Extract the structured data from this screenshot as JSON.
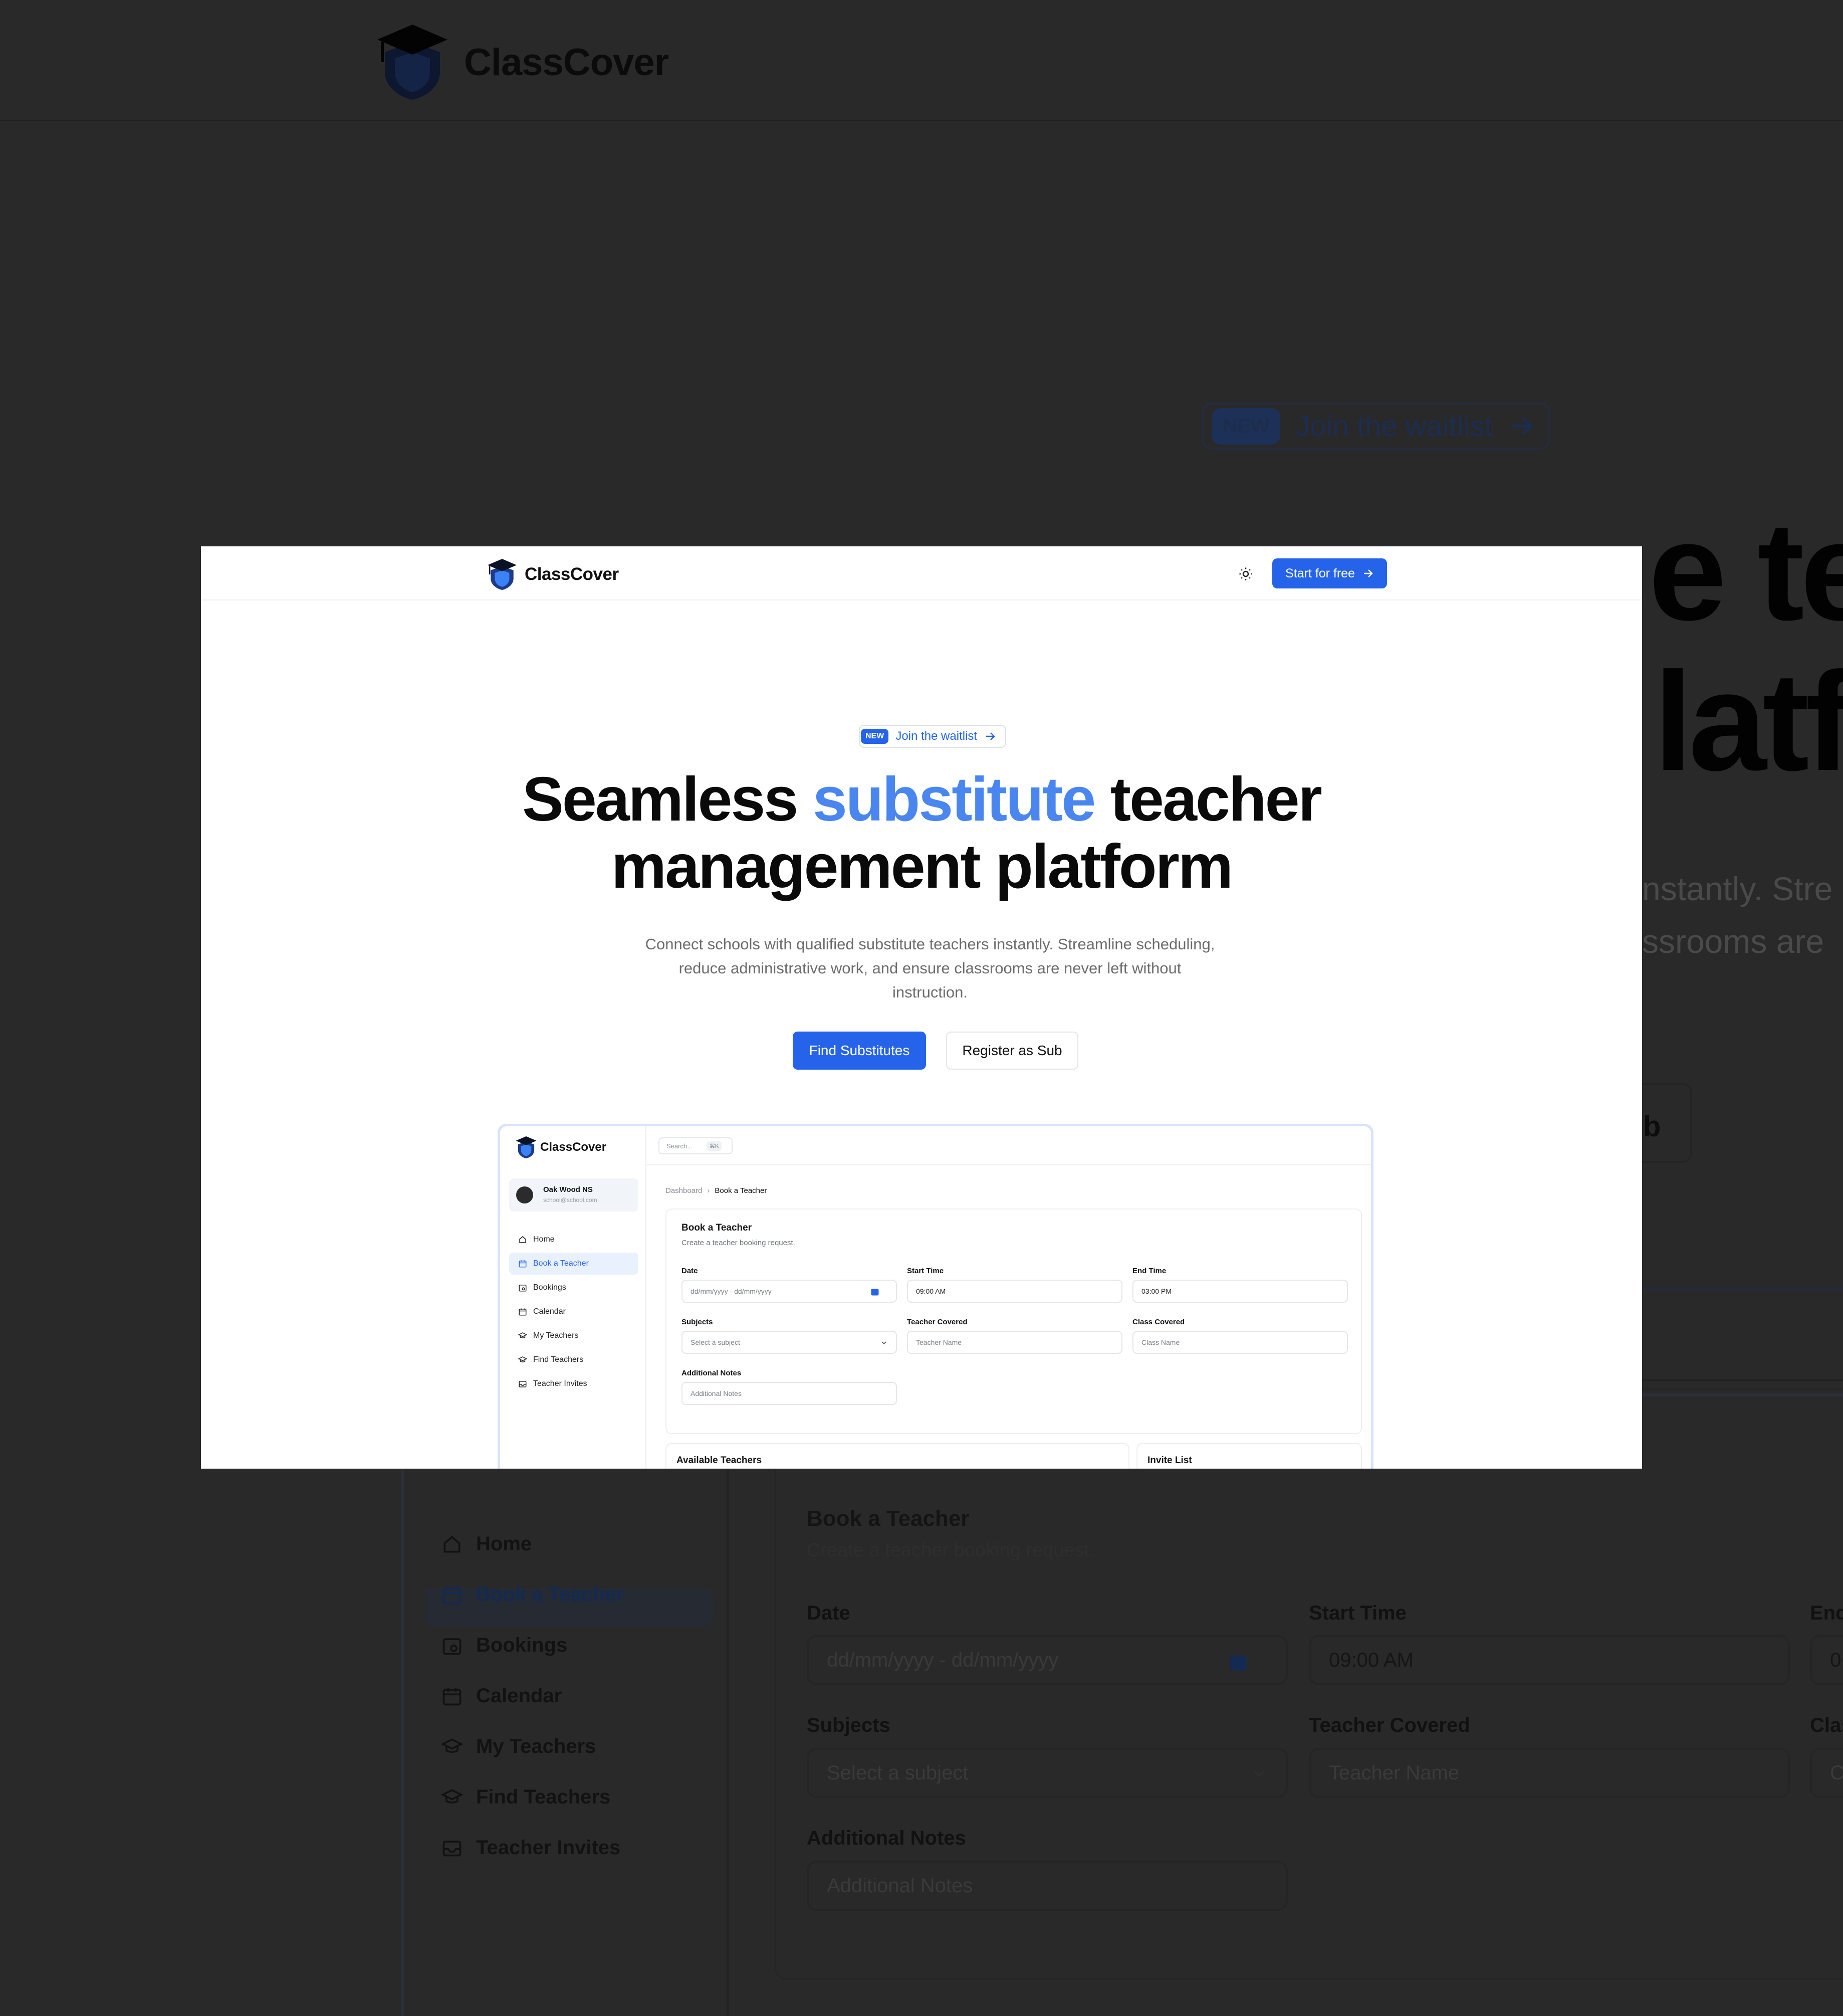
{
  "background": {
    "brand_name": "ClassCover",
    "pill_badge": "NEW",
    "pill_text": "Join the waitlist",
    "hero_line1_fragment": "e te",
    "hero_line2_fragment": "latfo",
    "sub_line1_fragment": "nstantly. Stre",
    "sub_line2_fragment": "ssrooms are",
    "btn_fragment": "b",
    "sidebar": [
      "Home",
      "Book a Teacher",
      "Bookings",
      "Calendar",
      "My Teachers",
      "Find Teachers",
      "Teacher Invites"
    ],
    "card_title": "Book a Teacher",
    "card_desc": "Create a teacher booking request.",
    "fields": {
      "date_label": "Date",
      "date_placeholder": "dd/mm/yyyy - dd/mm/yyyy",
      "start_label": "Start Time",
      "start_value": "09:00 AM",
      "end_label": "End",
      "end_value": "0",
      "subjects_label": "Subjects",
      "subjects_placeholder": "Select a subject",
      "teacher_label": "Teacher Covered",
      "teacher_placeholder": "Teacher Name",
      "class_label": "Clas",
      "class_placeholder": "C",
      "notes_label": "Additional Notes",
      "notes_placeholder": "Additional Notes"
    }
  },
  "nav": {
    "brand_name": "ClassCover",
    "start_label": "Start for free"
  },
  "hero": {
    "pill_badge": "NEW",
    "pill_text": "Join the waitlist",
    "title_before": "Seamless ",
    "title_accent": "substitute",
    "title_after": " teacher",
    "title_line2": "management platform",
    "subtitle": "Connect schools with qualified substitute teachers instantly. Streamline scheduling, reduce administrative work, and ensure classrooms are never left without instruction.",
    "primary_cta": "Find Substitutes",
    "secondary_cta": "Register as Sub"
  },
  "app_preview": {
    "brand_name": "ClassCover",
    "search_placeholder": "Search...",
    "search_shortcut": "⌘K",
    "org_name": "Oak Wood NS",
    "org_email": "school@school.com",
    "sidebar": [
      {
        "label": "Home",
        "icon": "home-icon"
      },
      {
        "label": "Book a Teacher",
        "icon": "calendar-plus-icon"
      },
      {
        "label": "Bookings",
        "icon": "calendar-clock-icon"
      },
      {
        "label": "Calendar",
        "icon": "calendar-icon"
      },
      {
        "label": "My Teachers",
        "icon": "graduation-cap-icon"
      },
      {
        "label": "Find Teachers",
        "icon": "graduation-cap-icon"
      },
      {
        "label": "Teacher Invites",
        "icon": "inbox-icon"
      }
    ],
    "active_index": 1,
    "breadcrumb_root": "Dashboard",
    "breadcrumb_sep": "›",
    "breadcrumb_current": "Book a Teacher",
    "card_title": "Book a Teacher",
    "card_desc": "Create a teacher booking request.",
    "date_label": "Date",
    "date_placeholder": "dd/mm/yyyy - dd/mm/yyyy",
    "start_label": "Start Time",
    "start_value": "09:00 AM",
    "end_label": "End Time",
    "end_value": "03:00 PM",
    "subjects_label": "Subjects",
    "subjects_placeholder": "Select a subject",
    "teacher_label": "Teacher Covered",
    "teacher_placeholder": "Teacher Name",
    "class_label": "Class Covered",
    "class_placeholder": "Class Name",
    "notes_label": "Additional Notes",
    "notes_placeholder": "Additional Notes",
    "available_title": "Available Teachers",
    "invite_title": "Invite List"
  },
  "colors": {
    "accent": "#2563eb",
    "hero_accent": "#4a86ef",
    "overlay_bg": "#292929"
  }
}
